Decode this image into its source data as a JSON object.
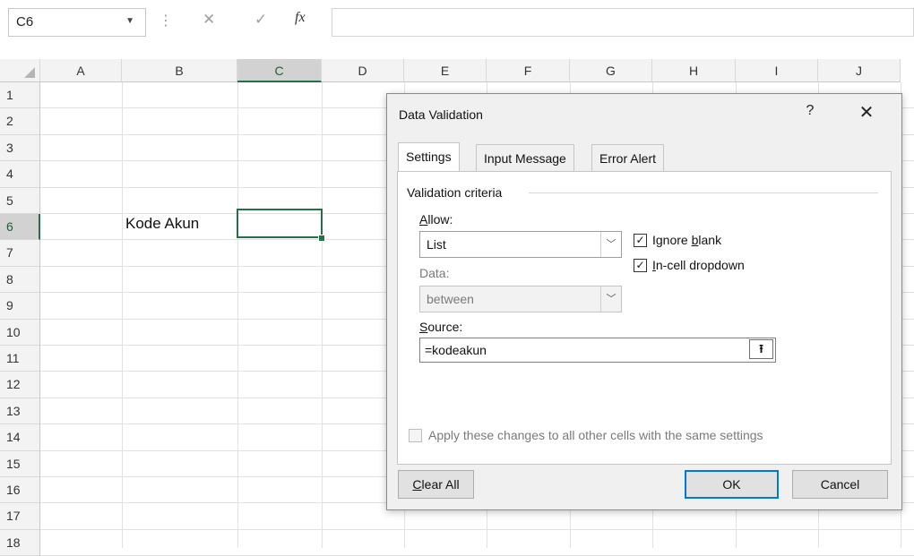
{
  "formula_bar": {
    "name_box": "C6",
    "dropdown_icon": "chevron-down-icon",
    "more_icon": "vertical-dots-icon",
    "cancel_icon": "x-icon",
    "enter_icon": "checkmark-icon",
    "fx_label": "fx",
    "formula": ""
  },
  "grid": {
    "columns": [
      "A",
      "B",
      "C",
      "D",
      "E",
      "F",
      "G",
      "H",
      "I",
      "J"
    ],
    "rows": [
      "1",
      "2",
      "3",
      "4",
      "5",
      "6",
      "7",
      "8",
      "9",
      "10",
      "11",
      "12",
      "13",
      "14",
      "15",
      "16",
      "17",
      "18"
    ],
    "selected_column": "C",
    "selected_row": "6",
    "cells": {
      "B6": "Kode Akun",
      "C6": ""
    },
    "accent_color": "#217346"
  },
  "dialog": {
    "title": "Data Validation",
    "help_label": "?",
    "close_label": "✕",
    "tabs": [
      "Settings",
      "Input Message",
      "Error Alert"
    ],
    "active_tab": "Settings",
    "group_label": "Validation criteria",
    "allow": {
      "label_pre": "",
      "label_u": "A",
      "label_post": "llow:",
      "value": "List"
    },
    "ignore_blank": {
      "label_pre": "Ignore ",
      "label_u": "b",
      "label_post": "lank",
      "checked": true
    },
    "in_cell_dropdown": {
      "label_pre": "",
      "label_u": "I",
      "label_post": "n-cell dropdown",
      "checked": true
    },
    "data": {
      "label": "Data:",
      "value": "between",
      "disabled": true
    },
    "source": {
      "label_pre": "",
      "label_u": "S",
      "label_post": "ource:",
      "value": "=kodeakun",
      "picker_icon": "collapse-dialog-icon"
    },
    "apply_all": {
      "label": "Apply these changes to all other cells with the same settings",
      "checked": false,
      "disabled": true
    },
    "buttons": {
      "clear_all_u": "C",
      "clear_all_rest": "lear All",
      "ok": "OK",
      "cancel": "Cancel"
    },
    "ok_border_color": "#0078d7"
  }
}
